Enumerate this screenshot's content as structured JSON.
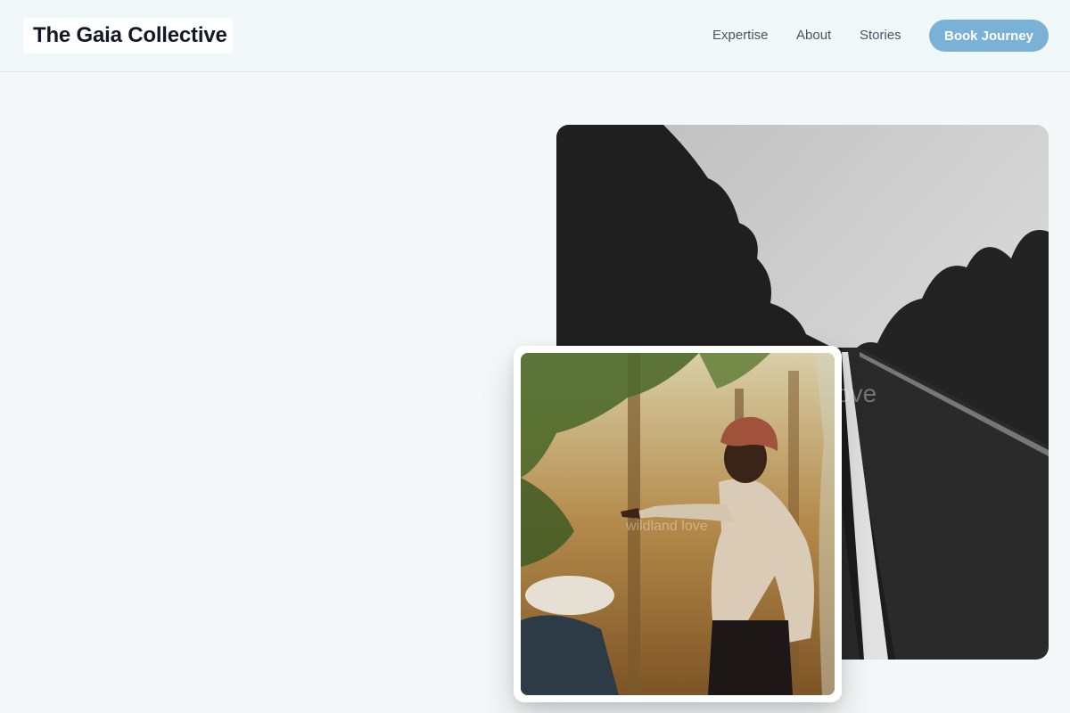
{
  "header": {
    "brand": "The Gaia Collective",
    "nav": [
      "Expertise",
      "About",
      "Stories"
    ],
    "cta_label": "Book Journey"
  },
  "hero": {
    "back_photo": {
      "watermark": "ove",
      "subject": "black-and-white tree-lined road"
    },
    "front_photo": {
      "watermark": "wildland love",
      "subject": "man in turban pointing through foliage"
    }
  },
  "colors": {
    "page_bg": "#f4f8f9",
    "header_bg": "#f1f8f9",
    "cta_bg": "#7ab1d6",
    "brand_text": "#121826",
    "nav_text": "#4b5563"
  }
}
